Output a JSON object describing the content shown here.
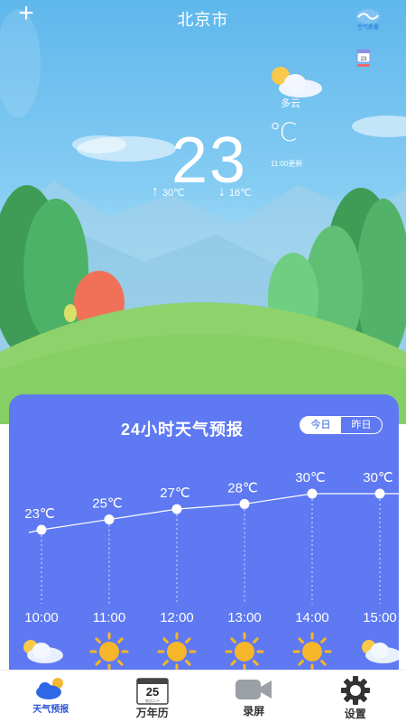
{
  "header": {
    "city": "北京市",
    "aq_label": "空气质量"
  },
  "current": {
    "condition": "多云",
    "temperature": "23",
    "unit": "℃",
    "update_time": "11:00更新",
    "high": "30℃",
    "low": "16℃"
  },
  "forecast": {
    "title": "24小时天气预报",
    "toggle": [
      "今日",
      "昨日"
    ],
    "active_toggle": 0
  },
  "chart_data": {
    "type": "line",
    "x": [
      "10:00",
      "11:00",
      "12:00",
      "13:00",
      "14:00",
      "15:00"
    ],
    "series": [
      {
        "values": [
          23,
          25,
          27,
          28,
          30,
          30
        ]
      }
    ],
    "labels": [
      "23℃",
      "25℃",
      "27℃",
      "28℃",
      "30℃",
      "30℃"
    ],
    "conditions": [
      "cloudy-icon",
      "sunny-icon",
      "sunny-icon",
      "sunny-icon",
      "sunny-icon",
      "cloudy-icon"
    ]
  },
  "tabs": [
    {
      "label": "天气预报",
      "icon": "weather-icon",
      "active": true
    },
    {
      "label": "万年历",
      "icon": "calendar-icon",
      "active": false,
      "calendar_day": "25",
      "calendar_sub": "农历二十"
    },
    {
      "label": "录屏",
      "icon": "video-camera-icon",
      "active": false
    },
    {
      "label": "设置",
      "icon": "gear-icon",
      "active": false
    }
  ],
  "colors": {
    "card": "#5e79f2",
    "accent": "#2a55d9",
    "sky_top": "#5fb7ec"
  }
}
